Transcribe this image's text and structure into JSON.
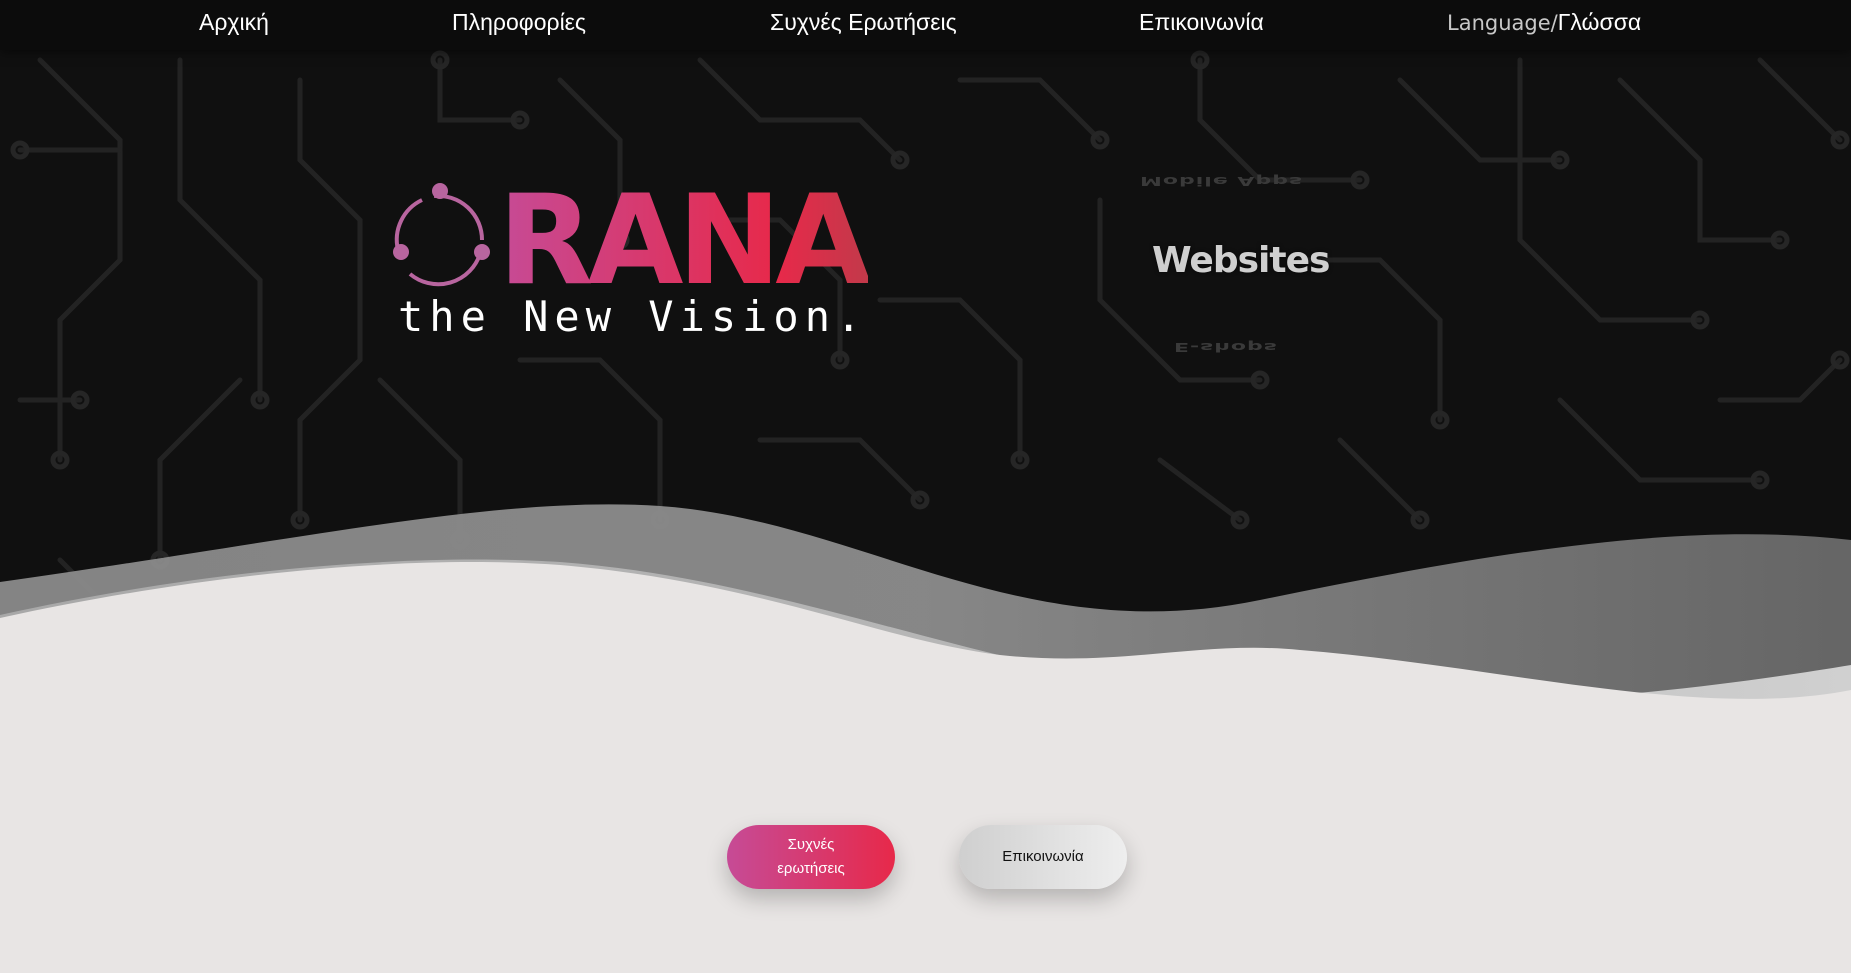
{
  "nav": {
    "items": [
      {
        "label": "Αρχική"
      },
      {
        "label": "Πληροφορίες"
      },
      {
        "label": "Συχνές Ερωτήσεις"
      },
      {
        "label": "Επικοινωνία"
      }
    ],
    "language_en": "Language/",
    "language_gr": "Γλώσσα"
  },
  "hero": {
    "logo_text": "RANA",
    "tagline": "the New Vision.",
    "rotator": {
      "previous": "Mobile Apps",
      "current": "Websites",
      "next": "E-shops"
    }
  },
  "buttons": {
    "faq_label": "Συχνές ερωτήσεις",
    "contact_label": "Επικοινωνία"
  },
  "colors": {
    "brand_pink": "#c64b96",
    "brand_red": "#e7294a",
    "dark_bg": "#101010",
    "light_bg": "#e8e5e4"
  }
}
